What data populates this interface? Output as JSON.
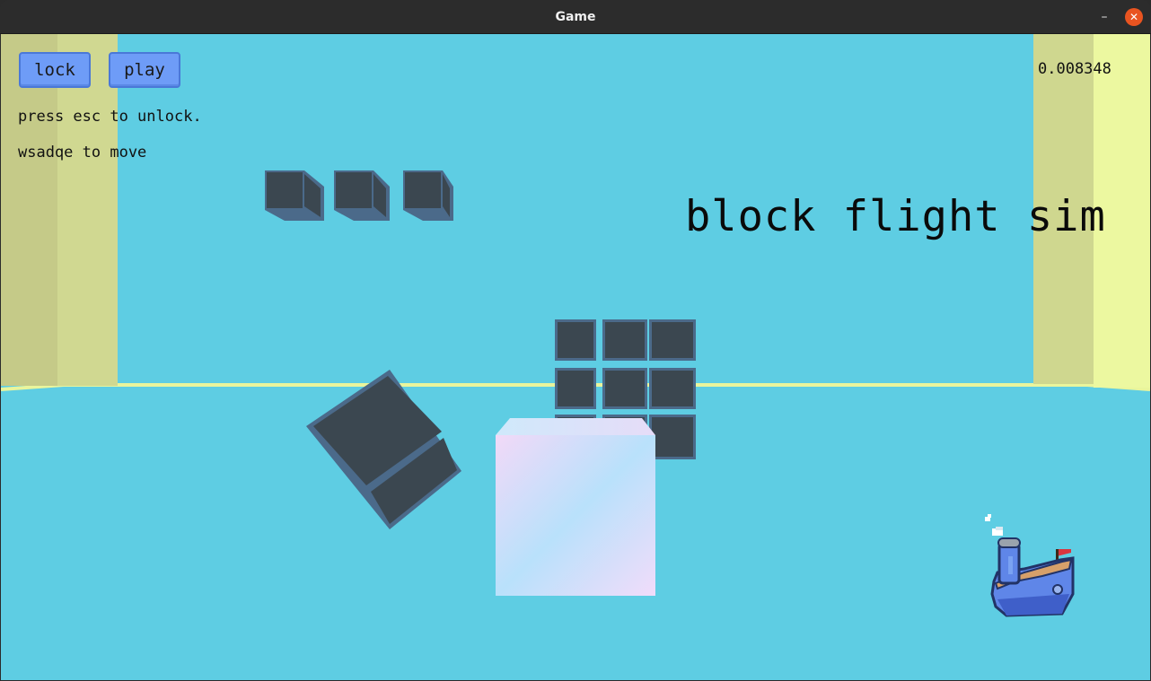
{
  "window": {
    "title": "Game",
    "minimize_icon": "minimize-icon",
    "close_icon": "close-icon"
  },
  "hud": {
    "lock_label": "lock",
    "play_label": "play",
    "instruction_unlock": "press esc to unlock.",
    "instruction_move": "wsadqe to move",
    "timer_value": "0.008348",
    "scene_title": "block flight sim"
  },
  "colors": {
    "sky": "#5ecde3",
    "ground": "#5ecde3",
    "wall_near": "#e9f59c",
    "wall_mid": "#cbd68f",
    "cube_dark": "#3b4750",
    "cube_edge": "#4b6a8a",
    "button_fill": "#6e9cf7",
    "close_button": "#e95420"
  },
  "scene_objects": {
    "floating_cubes_row": 3,
    "cube_grid": "3x3",
    "tilted_cube": "dark cube",
    "player_cube": "gradient cube",
    "boat_icon": "boat-icon"
  }
}
